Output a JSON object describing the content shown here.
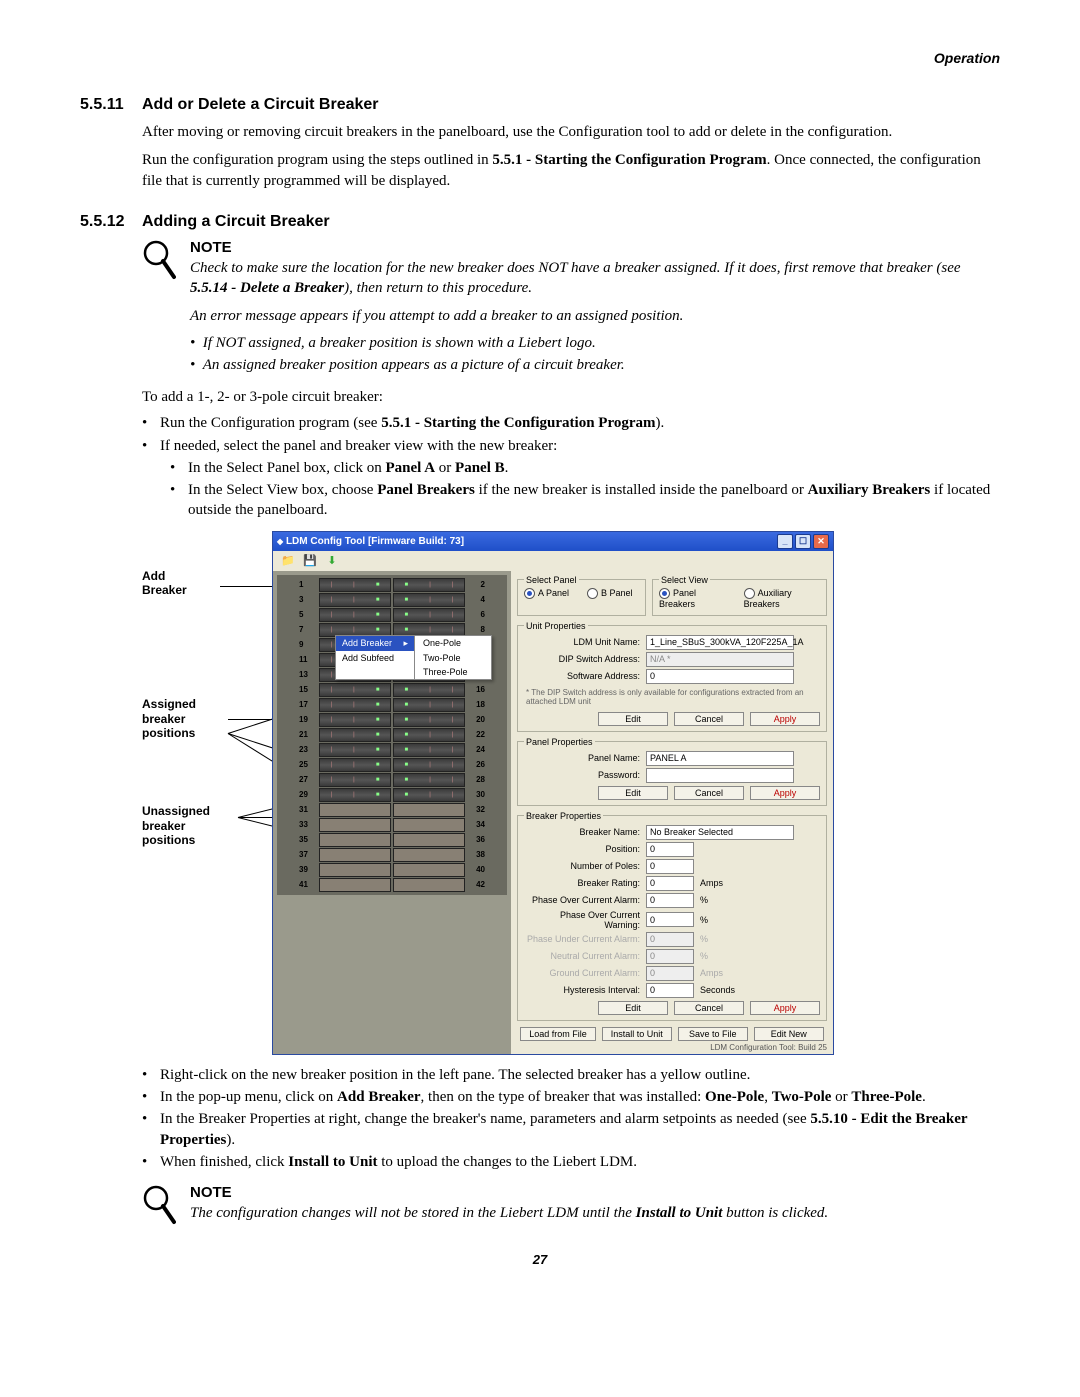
{
  "header": "Operation",
  "s1": {
    "num": "5.5.11",
    "title": "Add or Delete a Circuit Breaker",
    "p1": "After moving or removing circuit breakers in the panelboard, use the Configuration tool to add or delete in the configuration.",
    "p2a": "Run the configuration program using the steps outlined in ",
    "p2b": "5.5.1 - Starting the Configuration Program",
    "p2c": ". Once connected, the configuration file that is currently programmed will be displayed."
  },
  "s2": {
    "num": "5.5.12",
    "title": "Adding a Circuit Breaker"
  },
  "note1": {
    "title": "NOTE",
    "line1a": "Check to make sure the location for the new breaker does NOT have a breaker assigned. If it does, first remove that breaker (see ",
    "line1b": "5.5.14 - Delete a Breaker",
    "line1c": "), then return to this procedure.",
    "line2": "An error message appears if you attempt to add a breaker to an assigned position.",
    "b1": "If NOT assigned, a breaker position is shown with a Liebert logo.",
    "b2": "An assigned breaker position appears as a picture of a circuit breaker."
  },
  "intro": "To add a 1-, 2- or 3-pole circuit breaker:",
  "bullets1": {
    "a1": "Run the Configuration program (see ",
    "a2": "5.5.1 - Starting the Configuration Program",
    "a3": ").",
    "b": "If needed, select the panel and breaker view with the new breaker:",
    "c1": "In the Select Panel box, click on ",
    "c2": "Panel A",
    "c3": " or ",
    "c4": "Panel B",
    "c5": ".",
    "d1": "In the Select View box, choose ",
    "d2": "Panel Breakers",
    "d3": " if the new breaker is installed inside the panelboard or ",
    "d4": "Auxiliary Breakers",
    "d5": " if located outside the panelboard."
  },
  "labels": {
    "add": "Add\nBreaker",
    "assigned": "Assigned\nbreaker\npositions",
    "unassigned": "Unassigned\nbreaker\npositions"
  },
  "app": {
    "title": "LDM Config Tool [Firmware Build: 73]",
    "menu": {
      "addBreaker": "Add Breaker",
      "addSubfeed": "Add Subfeed",
      "onePole": "One-Pole",
      "twoPole": "Two-Pole",
      "threePole": "Three-Pole"
    },
    "selectPanel": {
      "legend": "Select Panel",
      "a": "A Panel",
      "b": "B Panel"
    },
    "selectView": {
      "legend": "Select View",
      "pb": "Panel Breakers",
      "aux": "Auxiliary Breakers"
    },
    "unitProps": {
      "legend": "Unit Properties",
      "ldmName": {
        "label": "LDM Unit Name:",
        "value": "1_Line_SBuS_300kVA_120F225A_1A"
      },
      "dip": {
        "label": "DIP Switch Address:",
        "value": "N/A *"
      },
      "soft": {
        "label": "Software Address:",
        "value": "0"
      },
      "hint": "* The DIP Switch address is only available for configurations extracted from an attached LDM unit",
      "edit": "Edit",
      "cancel": "Cancel",
      "apply": "Apply"
    },
    "panelProps": {
      "legend": "Panel Properties",
      "panelName": {
        "label": "Panel Name:",
        "value": "PANEL A"
      },
      "password": {
        "label": "Password:",
        "value": ""
      },
      "edit": "Edit",
      "cancel": "Cancel",
      "apply": "Apply"
    },
    "breakerProps": {
      "legend": "Breaker Properties",
      "name": {
        "label": "Breaker Name:",
        "value": "No Breaker Selected"
      },
      "position": {
        "label": "Position:",
        "value": "0"
      },
      "poles": {
        "label": "Number of Poles:",
        "value": "0"
      },
      "rating": {
        "label": "Breaker Rating:",
        "value": "0",
        "unit": "Amps"
      },
      "poc": {
        "label": "Phase Over Current Alarm:",
        "value": "0",
        "unit": "%"
      },
      "pocw": {
        "label": "Phase Over Current Warning:",
        "value": "0",
        "unit": "%"
      },
      "puc": {
        "label": "Phase Under Current Alarm:",
        "value": "0",
        "unit": "%"
      },
      "nca": {
        "label": "Neutral Current Alarm:",
        "value": "0",
        "unit": "%"
      },
      "gca": {
        "label": "Ground Current Alarm:",
        "value": "0",
        "unit": "Amps"
      },
      "hyst": {
        "label": "Hysteresis Interval:",
        "value": "0",
        "unit": "Seconds"
      },
      "edit": "Edit",
      "cancel": "Cancel",
      "apply": "Apply"
    },
    "bottom": {
      "load": "Load from File",
      "install": "Install to Unit",
      "save": "Save to File",
      "editNew": "Edit New"
    },
    "footer": "LDM Configuration Tool: Build 25"
  },
  "bullets2": {
    "a": "Right-click on the new breaker position in the left pane. The selected breaker has a yellow outline.",
    "b1": "In the pop-up menu, click on ",
    "b2": "Add Breaker",
    "b3": ", then on the type of breaker that was installed: ",
    "b4": "One-Pole",
    "b5": ", ",
    "b6": "Two-Pole",
    "b7": " or ",
    "b8": "Three-Pole",
    "b9": ".",
    "c1": "In the Breaker Properties at right, change the breaker's name, parameters and alarm setpoints as needed (see ",
    "c2": "5.5.10 - Edit the Breaker Properties",
    "c3": ").",
    "d1": "When finished, click ",
    "d2": "Install to Unit",
    "d3": " to upload the changes to the Liebert LDM."
  },
  "note2": {
    "title": "NOTE",
    "text1": "The configuration changes will not be stored in the Liebert LDM until the ",
    "bold": "Install to Unit",
    "text2": " button is clicked."
  },
  "pageNum": "27"
}
